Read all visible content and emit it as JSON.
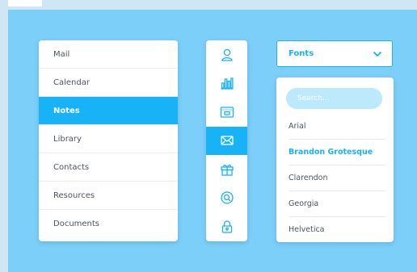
{
  "theme": {
    "accent": "#17b3f6",
    "background": "#7ccff9",
    "search_bg": "#bde9fc"
  },
  "menu": {
    "items": [
      {
        "label": "Mail",
        "active": false
      },
      {
        "label": "Calendar",
        "active": false
      },
      {
        "label": "Notes",
        "active": true
      },
      {
        "label": "Library",
        "active": false
      },
      {
        "label": "Contacts",
        "active": false
      },
      {
        "label": "Resources",
        "active": false
      },
      {
        "label": "Documents",
        "active": false
      }
    ]
  },
  "iconbar": {
    "items": [
      {
        "icon": "user-icon",
        "active": false
      },
      {
        "icon": "bar-chart-icon",
        "active": false
      },
      {
        "icon": "browser-window-icon",
        "active": false
      },
      {
        "icon": "envelope-icon",
        "active": true
      },
      {
        "icon": "gift-icon",
        "active": false
      },
      {
        "icon": "search-circle-icon",
        "active": false
      },
      {
        "icon": "lock-icon",
        "active": false
      }
    ]
  },
  "font_select": {
    "label": "Fonts",
    "icon": "chevron-down-icon",
    "search_placeholder": "Search...",
    "options": [
      {
        "label": "Arial",
        "active": false
      },
      {
        "label": "Brandon Grotesque",
        "active": true
      },
      {
        "label": "Clarendon",
        "active": false
      },
      {
        "label": "Georgia",
        "active": false
      },
      {
        "label": "Helvetica",
        "active": false
      }
    ]
  }
}
